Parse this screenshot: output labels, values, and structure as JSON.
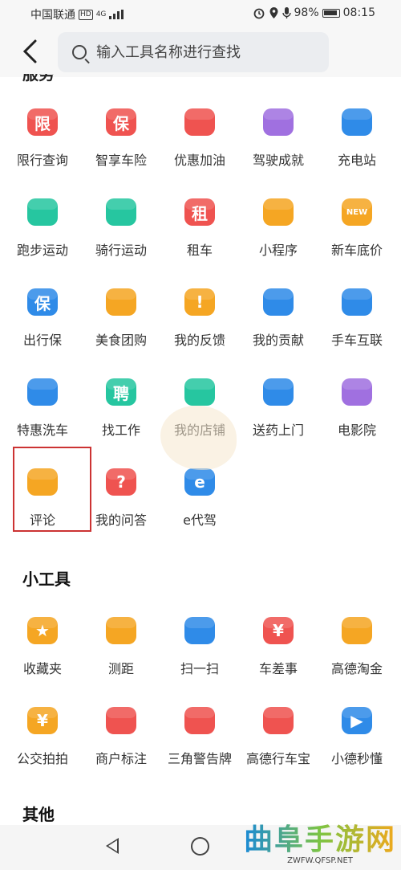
{
  "status_bar": {
    "carrier": "中国联通",
    "network_badge": "HD",
    "network_type": "4G",
    "battery": "98%",
    "time": "08:15"
  },
  "search": {
    "placeholder": "输入工具名称进行查找"
  },
  "sections": {
    "services_cut_title": "服务",
    "services": [
      {
        "label": "限行查询",
        "icon": "restriction-icon",
        "color": "#ef5350",
        "glyph": "限"
      },
      {
        "label": "智享车险",
        "icon": "car-insurance-icon",
        "color": "#ef5350",
        "glyph": "保"
      },
      {
        "label": "优惠加油",
        "icon": "fuel-pump-icon",
        "color": "#ef5350",
        "glyph": ""
      },
      {
        "label": "驾驶成就",
        "icon": "trophy-icon",
        "color": "#a070e0",
        "glyph": ""
      },
      {
        "label": "充电站",
        "icon": "charging-station-icon",
        "color": "#2f8be8",
        "glyph": ""
      },
      {
        "label": "跑步运动",
        "icon": "running-icon",
        "color": "#26c6a0",
        "glyph": ""
      },
      {
        "label": "骑行运动",
        "icon": "cycling-icon",
        "color": "#26c6a0",
        "glyph": ""
      },
      {
        "label": "租车",
        "icon": "car-rental-icon",
        "color": "#ef5350",
        "glyph": "租"
      },
      {
        "label": "小程序",
        "icon": "mini-program-icon",
        "color": "#f5a623",
        "glyph": ""
      },
      {
        "label": "新车底价",
        "icon": "new-car-icon",
        "color": "#f5a623",
        "glyph": "NEW"
      },
      {
        "label": "出行保",
        "icon": "travel-shield-icon",
        "color": "#2f8be8",
        "glyph": "保"
      },
      {
        "label": "美食团购",
        "icon": "food-icon",
        "color": "#f5a623",
        "glyph": ""
      },
      {
        "label": "我的反馈",
        "icon": "feedback-icon",
        "color": "#f5a623",
        "glyph": "!"
      },
      {
        "label": "我的贡献",
        "icon": "thumbs-up-icon",
        "color": "#2f8be8",
        "glyph": ""
      },
      {
        "label": "手车互联",
        "icon": "phone-car-link-icon",
        "color": "#2f8be8",
        "glyph": ""
      },
      {
        "label": "特惠洗车",
        "icon": "car-wash-icon",
        "color": "#2f8be8",
        "glyph": ""
      },
      {
        "label": "找工作",
        "icon": "job-icon",
        "color": "#26c6a0",
        "glyph": "聘"
      },
      {
        "label": "我的店铺",
        "icon": "shop-icon",
        "color": "#26c6a0",
        "glyph": ""
      },
      {
        "label": "送药上门",
        "icon": "medicine-icon",
        "color": "#2f8be8",
        "glyph": ""
      },
      {
        "label": "电影院",
        "icon": "film-reel-icon",
        "color": "#a070e0",
        "glyph": ""
      },
      {
        "label": "评论",
        "icon": "comment-icon",
        "color": "#f5a623",
        "glyph": ""
      },
      {
        "label": "我的问答",
        "icon": "qa-icon",
        "color": "#ef5350",
        "glyph": "?"
      },
      {
        "label": "e代驾",
        "icon": "e-driver-icon",
        "color": "#2f8be8",
        "glyph": "e"
      }
    ],
    "tools_title": "小工具",
    "tools": [
      {
        "label": "收藏夹",
        "icon": "star-icon",
        "color": "#f5a623",
        "glyph": "★"
      },
      {
        "label": "测距",
        "icon": "ruler-icon",
        "color": "#f5a623",
        "glyph": ""
      },
      {
        "label": "扫一扫",
        "icon": "scan-icon",
        "color": "#2f8be8",
        "glyph": ""
      },
      {
        "label": "车差事",
        "icon": "car-errand-icon",
        "color": "#ef5350",
        "glyph": "¥"
      },
      {
        "label": "高德淘金",
        "icon": "paper-plane-icon",
        "color": "#f5a623",
        "glyph": ""
      },
      {
        "label": "公交拍拍",
        "icon": "bus-photo-icon",
        "color": "#f5a623",
        "glyph": "¥"
      },
      {
        "label": "商户标注",
        "icon": "merchant-mark-icon",
        "color": "#ef5350",
        "glyph": ""
      },
      {
        "label": "三角警告牌",
        "icon": "warning-triangle-icon",
        "color": "#ef5350",
        "glyph": ""
      },
      {
        "label": "高德行车宝",
        "icon": "dashcam-icon",
        "color": "#ef5350",
        "glyph": ""
      },
      {
        "label": "小德秒懂",
        "icon": "play-icon",
        "color": "#2f8be8",
        "glyph": "▶"
      }
    ],
    "other_title": "其他"
  },
  "watermark": {
    "title": "曲阜手游网",
    "url": "ZWFW.QFSP.NET"
  }
}
